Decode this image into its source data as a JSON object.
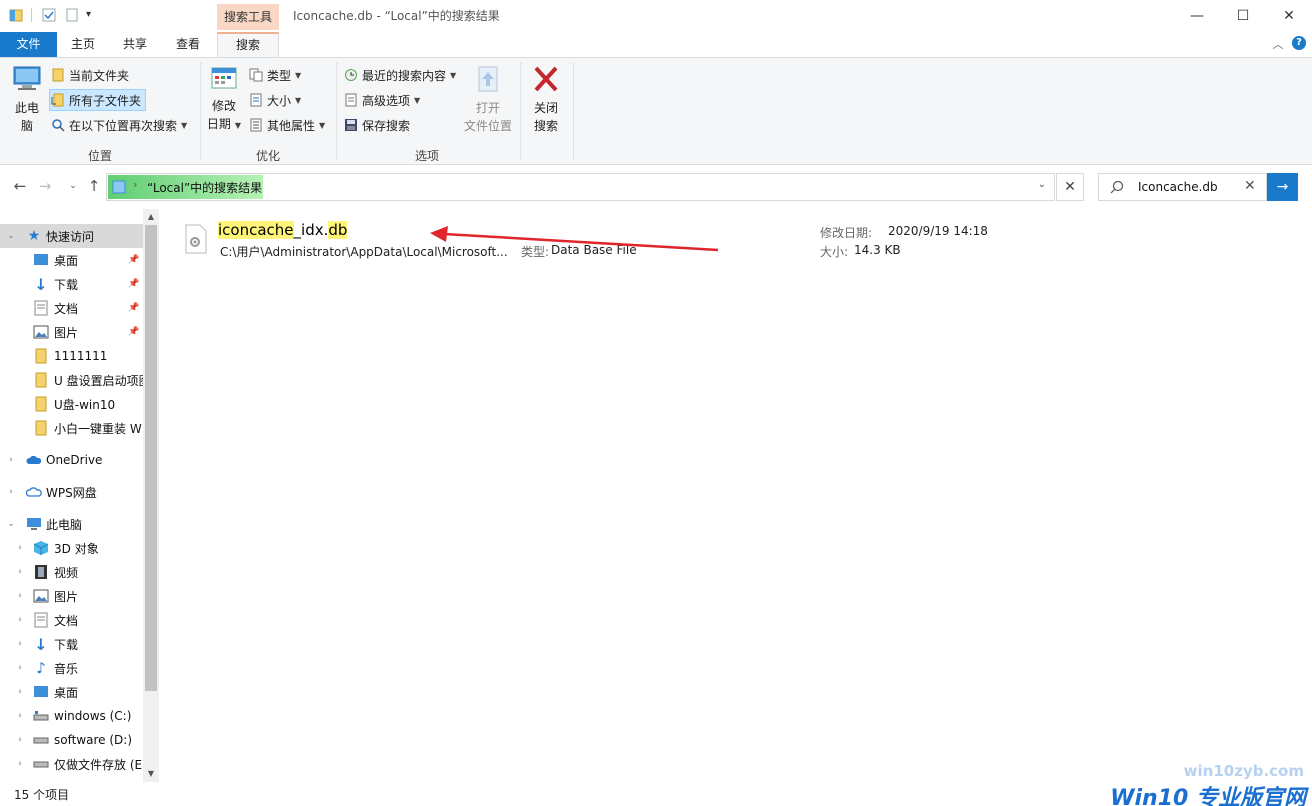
{
  "titlebar": {
    "context_tab_header": "搜索工具",
    "window_title": "Iconcache.db - “Local”中的搜索结果",
    "minimize": "—",
    "maximize": "☐",
    "close": "✕"
  },
  "tabs": {
    "file": "文件",
    "home": "主页",
    "share": "共享",
    "view": "查看",
    "search": "搜索"
  },
  "ribbon": {
    "location": {
      "label": "位置",
      "this_pc_line1": "此电",
      "this_pc_line2": "脑",
      "current_folder": "当前文件夹",
      "all_subfolders": "所有子文件夹",
      "search_again_in": "在以下位置再次搜索"
    },
    "refine": {
      "label": "优化",
      "date_modified_line1": "修改",
      "date_modified_line2": "日期",
      "kind": "类型",
      "size": "大小",
      "other_properties": "其他属性"
    },
    "options": {
      "label": "选项",
      "recent_searches": "最近的搜索内容",
      "advanced_options": "高级选项",
      "save_search": "保存搜索",
      "open_location_line1": "打开",
      "open_location_line2": "文件位置",
      "close_search_line1": "关闭",
      "close_search_line2": "搜索"
    }
  },
  "address": {
    "path": "“Local”中的搜索结果",
    "search_value": "Iconcache.db"
  },
  "navpane": {
    "quick_access": "快速访问",
    "items": [
      {
        "label": "桌面"
      },
      {
        "label": "下载"
      },
      {
        "label": "文档"
      },
      {
        "label": "图片"
      },
      {
        "label": "1111111"
      },
      {
        "label": "U 盘设置启动项图"
      },
      {
        "label": "U盘-win10"
      },
      {
        "label": "小白一键重装 W"
      }
    ],
    "onedrive": "OneDrive",
    "wps": "WPS网盘",
    "this_pc": "此电脑",
    "pc_items": [
      {
        "label": "3D 对象"
      },
      {
        "label": "视频"
      },
      {
        "label": "图片"
      },
      {
        "label": "文档"
      },
      {
        "label": "下载"
      },
      {
        "label": "音乐"
      },
      {
        "label": "桌面"
      },
      {
        "label": "windows (C:)"
      },
      {
        "label": "software (D:)"
      },
      {
        "label": "仅做文件存放 (E"
      }
    ]
  },
  "result": {
    "name_part1": "iconcache",
    "name_part2": "_idx.",
    "name_part3": "db",
    "path": "C:\\用户\\Administrator\\AppData\\Local\\Microsoft...",
    "type_label": "类型:",
    "type_value": "Data Base File",
    "date_label": "修改日期:",
    "date_value": "2020/9/19 14:18",
    "size_label": "大小:",
    "size_value": "14.3 KB"
  },
  "status": {
    "count": "15 个项目"
  },
  "watermark": {
    "url": "win10zyb.com",
    "brand": "Win10 专业版官网"
  },
  "colors": {
    "accent": "#1979ca",
    "context_tab": "#f8d7c5",
    "arrow": "#e0252b",
    "highlight": "#fff47a"
  }
}
